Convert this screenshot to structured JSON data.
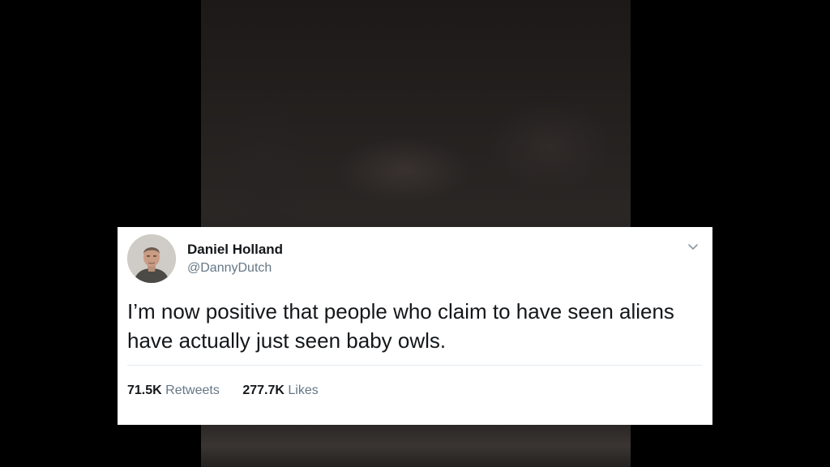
{
  "tweet": {
    "author_name": "Daniel Holland",
    "author_handle": "@DannyDutch",
    "text": "I’m now positive that people who claim to have seen aliens have actually just seen baby owls.",
    "retweets_count": "71.5K",
    "retweets_label": "Retweets",
    "likes_count": "277.7K",
    "likes_label": "Likes",
    "menu_icon": "chevron-down-icon",
    "avatar_icon": "avatar"
  },
  "colors": {
    "text_primary": "#14171a",
    "text_secondary": "#657786",
    "divider": "#e6ecf0",
    "card_background": "#ffffff",
    "page_background": "#000000"
  }
}
